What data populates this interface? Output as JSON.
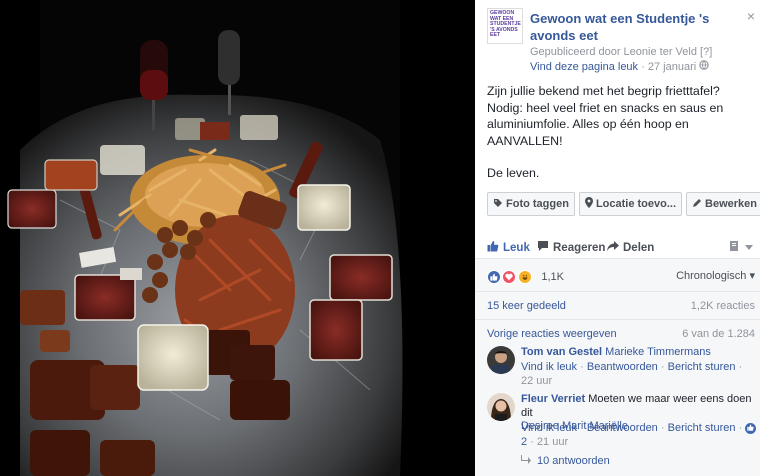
{
  "page": {
    "logo_lines": [
      "GEWOON",
      "WAT EEN",
      "STUDENTJE",
      "'S AVONDS",
      "EET"
    ],
    "name": "Gewoon wat een Studentje 's avonds eet",
    "published_by": "Gepubliceerd door Leonie ter Veld",
    "published_bracket": "[?]",
    "like_page": "Vind deze pagina leuk",
    "sep": "·",
    "date": "27 januari",
    "close_icon": "×"
  },
  "post": {
    "paragraph1": "Zijn jullie bekend met het begrip frietttafel? Nodig: heel veel friet en snacks en saus en aluminiumfolie. Alles op één hoop en AANVALLEN!",
    "paragraph2": "De leven."
  },
  "tag_buttons": {
    "photo_tag": "Foto taggen",
    "location": "Locatie toevo...",
    "edit": "Bewerken"
  },
  "actions": {
    "like": "Leuk",
    "comment": "Reageren",
    "share": "Delen"
  },
  "reactions": {
    "count": "1,1K",
    "sort": "Chronologisch",
    "sort_arrow": "▾",
    "colors": {
      "like": "#4267b2",
      "love": "#f25268",
      "haha": "#f7b125"
    }
  },
  "stats": {
    "shares": "15 keer gedeeld",
    "reactions": "1,2K reacties",
    "previous": "Vorige reacties weergeven",
    "shown_count": "6 van de 1.284"
  },
  "comments": [
    {
      "author": "Tom van Gestel",
      "text": "Marieke Timmermans",
      "like": "Vind ik leuk",
      "reply": "Beantwoorden",
      "message": "Bericht sturen",
      "time": "22 uur",
      "dot": "·"
    },
    {
      "author": "Fleur Verriet",
      "text": "Moeten we maar weer eens doen dit",
      "tag": "Desiree Marit Mariëlle",
      "like": "Vind ik leuk",
      "reply": "Beantwoorden",
      "message": "Bericht sturen",
      "badge_count": "2",
      "time": "21 uur",
      "dot": "·"
    }
  ],
  "replies": {
    "label": "10 antwoorden"
  }
}
